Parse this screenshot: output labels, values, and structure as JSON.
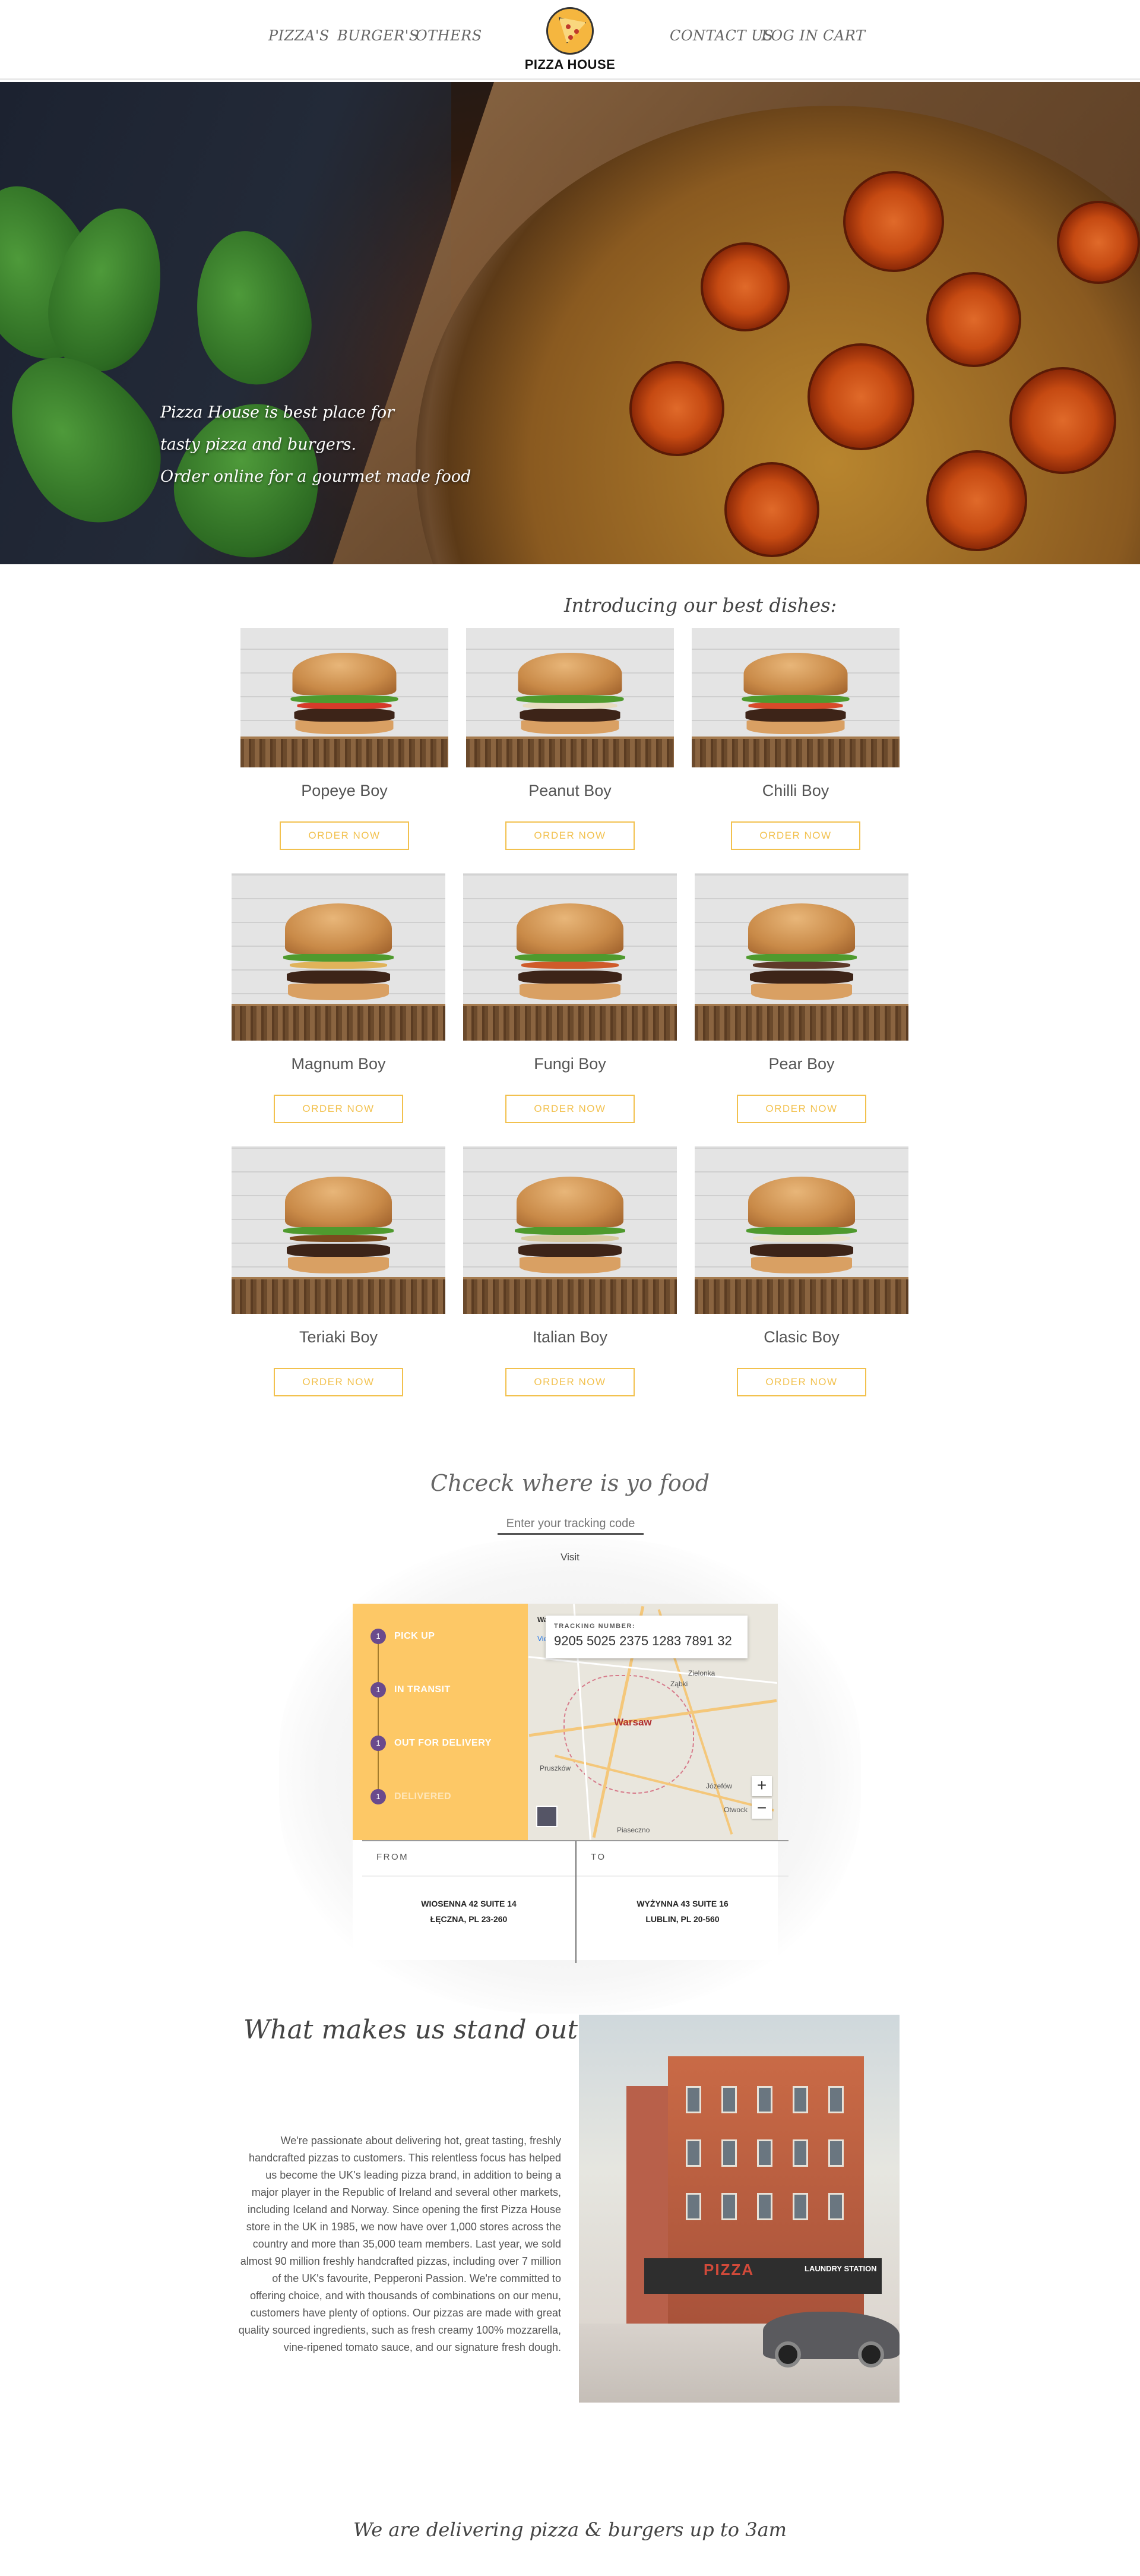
{
  "nav": {
    "left_links": [
      "PIZZA'S",
      "BURGER'S",
      "OTHERS"
    ],
    "right_links": [
      "CONTACT US",
      "LOG IN",
      "CART"
    ],
    "logo_text": "PIZZA HOUSE"
  },
  "hero": {
    "lines": [
      "Pizza House is best place for",
      "tasty pizza and burgers.",
      "Order online for a gourmet made food"
    ]
  },
  "dishes": {
    "heading": "Introducing our best dishes:",
    "order_label": "ORDER NOW",
    "items": [
      {
        "name": "Popeye Boy"
      },
      {
        "name": "Peanut Boy"
      },
      {
        "name": "Chilli Boy"
      },
      {
        "name": "Magnum Boy"
      },
      {
        "name": "Fungi Boy"
      },
      {
        "name": "Pear Boy"
      },
      {
        "name": "Teriaki Boy"
      },
      {
        "name": "Italian Boy"
      },
      {
        "name": "Clasic Boy"
      }
    ]
  },
  "tracking": {
    "title": "Chceck where is yo food",
    "input_placeholder": "Enter your tracking code",
    "visit_label": "Visit",
    "steps": [
      "PICK UP",
      "IN TRANSIT",
      "OUT FOR DELIVERY",
      "DELIVERED"
    ],
    "tracking_number_caption": "TRACKING NUMBER:",
    "tracking_number": "9205 5025 2375 1283 7891 32",
    "map": {
      "city": "Warsaw",
      "labels": [
        "Zielonka",
        "Ząbki",
        "Pruszków",
        "Józefów",
        "Otwock",
        "Piaseczno"
      ],
      "zoom_in": "+",
      "zoom_out": "−",
      "map_type_label": "Wa",
      "view_label": "View"
    },
    "from": {
      "heading": "FROM",
      "line1": "WIOSENNA 42 SUITE 14",
      "line2": "ŁĘCZNA, PL 23-260"
    },
    "to": {
      "heading": "TO",
      "line1": "WYŻYNNA 43 SUITE 16",
      "line2": "LUBLIN, PL 20-560"
    }
  },
  "about": {
    "title": "What makes us stand out",
    "text": "We're passionate about delivering hot, great tasting, freshly handcrafted pizzas to customers. This relentless focus has helped us become the UK's leading pizza brand, in addition to being a major player in the Republic of Ireland and several other markets, including Iceland and Norway. Since opening the first Pizza House store in the UK in 1985, we now have over 1,000 stores across the country and more than 35,000 team members. Last year, we sold almost 90 million freshly handcrafted pizzas, including over 7 million of the UK's favourite, Pepperoni Passion. We're committed to offering choice, and with thousands of combinations on our menu, customers have plenty of options. Our pizzas are made with great quality sourced ingredients, such as fresh creamy 100% mozzarella, vine-ripened tomato sauce, and our signature fresh dough.",
    "photo_signs": [
      "PIZZA",
      "LAUNDRY STATION"
    ]
  },
  "footer": {
    "text": "We are delivering pizza & burgers up to 3am"
  }
}
